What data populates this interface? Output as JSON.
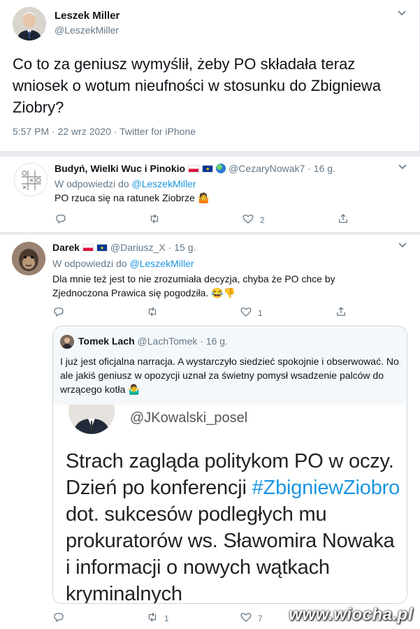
{
  "main_tweet": {
    "name": "Leszek Miller",
    "handle": "@LeszekMiller",
    "text": "Co to za geniusz wymyślił, żeby PO składała teraz wniosek o wotum nieufności w stosunku do Zbigniewa Ziobry?",
    "time": "5:57 PM",
    "date": "22 wrz 2020",
    "source": "Twitter for iPhone",
    "dot": "·"
  },
  "reply1": {
    "name": "Budyń, Wielki Wuc i Pinokio",
    "handle": "@CezaryNowak7",
    "time": "· 16 g.",
    "in_reply_prefix": "W odpowiedzi do",
    "in_reply_handle": "@LeszekMiller",
    "text": "PO rzuca się na ratunek Ziobrze",
    "text_emoji": "🤷",
    "likes": "2"
  },
  "reply2": {
    "name": "Darek",
    "handle": "@Dariusz_X",
    "time": "· 15 g.",
    "in_reply_prefix": "W odpowiedzi do",
    "in_reply_handle": "@LeszekMiller",
    "text": "Dla mnie też jest to nie zrozumiała decyzja, chyba że PO chce by Zjednoczona Prawica się pogodziła.",
    "text_emoji": "😂👎",
    "likes": "1",
    "quote": {
      "name": "Tomek Lach",
      "handle": "@LachTomek",
      "time": "· 16 g.",
      "text": "I już jest oficjalna narracja. A wystarczyło siedzieć spokojnie i obserwować. No ale jakiś geniusz w opozycji uznał za świetny pomysł wsadzenie palców do wrzącego kotła",
      "text_emoji": "🤷‍♂️",
      "image_handle": "@JKowalski_posel",
      "image_text_1": "Strach zagląda politykom PO w oczy. Dzień po konferencji",
      "image_hashtag": "#ZbigniewZiobro",
      "image_text_2": "dot. sukcesów podległych mu prokuratorów ws. Sławomira Nowaka i informacji o nowych wątkach kryminalnych"
    },
    "retweets_bottom": "1",
    "likes_bottom": "7"
  },
  "watermark": "www.wiocha.pl",
  "colors": {
    "link": "#1b95e0",
    "muted": "#657786",
    "background": "#e9ecef"
  }
}
